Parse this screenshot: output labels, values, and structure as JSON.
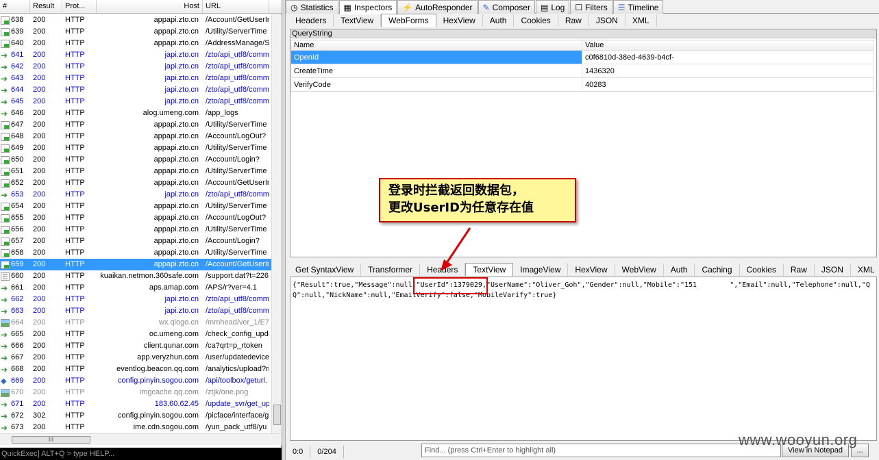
{
  "sessions": {
    "columns": [
      "#",
      "Result",
      "Prot...",
      "Host",
      "URL"
    ],
    "rows": [
      {
        "id": "638",
        "result": "200",
        "protocol": "HTTP",
        "host": "appapi.zto.cn",
        "url": "/Account/GetUserIn",
        "style": "normal",
        "icon": "js"
      },
      {
        "id": "639",
        "result": "200",
        "protocol": "HTTP",
        "host": "appapi.zto.cn",
        "url": "/Utility/ServerTime",
        "style": "normal",
        "icon": "js"
      },
      {
        "id": "640",
        "result": "200",
        "protocol": "HTTP",
        "host": "appapi.zto.cn",
        "url": "/AddressManage/Se",
        "style": "normal",
        "icon": "js"
      },
      {
        "id": "641",
        "result": "200",
        "protocol": "HTTP",
        "host": "japi.zto.cn",
        "url": "/zto/api_utf8/comm",
        "style": "blue",
        "icon": "arrow"
      },
      {
        "id": "642",
        "result": "200",
        "protocol": "HTTP",
        "host": "japi.zto.cn",
        "url": "/zto/api_utf8/comm",
        "style": "blue",
        "icon": "arrow"
      },
      {
        "id": "643",
        "result": "200",
        "protocol": "HTTP",
        "host": "japi.zto.cn",
        "url": "/zto/api_utf8/comm",
        "style": "blue",
        "icon": "arrow"
      },
      {
        "id": "644",
        "result": "200",
        "protocol": "HTTP",
        "host": "japi.zto.cn",
        "url": "/zto/api_utf8/comm",
        "style": "blue",
        "icon": "arrow"
      },
      {
        "id": "645",
        "result": "200",
        "protocol": "HTTP",
        "host": "japi.zto.cn",
        "url": "/zto/api_utf8/comm",
        "style": "blue",
        "icon": "arrow"
      },
      {
        "id": "646",
        "result": "200",
        "protocol": "HTTP",
        "host": "alog.umeng.com",
        "url": "/app_logs",
        "style": "normal",
        "icon": "arrow"
      },
      {
        "id": "647",
        "result": "200",
        "protocol": "HTTP",
        "host": "appapi.zto.cn",
        "url": "/Utility/ServerTime",
        "style": "normal",
        "icon": "js"
      },
      {
        "id": "648",
        "result": "200",
        "protocol": "HTTP",
        "host": "appapi.zto.cn",
        "url": "/Account/LogOut?",
        "style": "normal",
        "icon": "js"
      },
      {
        "id": "649",
        "result": "200",
        "protocol": "HTTP",
        "host": "appapi.zto.cn",
        "url": "/Utility/ServerTime",
        "style": "normal",
        "icon": "js"
      },
      {
        "id": "650",
        "result": "200",
        "protocol": "HTTP",
        "host": "appapi.zto.cn",
        "url": "/Account/Login?",
        "style": "normal",
        "icon": "js"
      },
      {
        "id": "651",
        "result": "200",
        "protocol": "HTTP",
        "host": "appapi.zto.cn",
        "url": "/Utility/ServerTime",
        "style": "normal",
        "icon": "js"
      },
      {
        "id": "652",
        "result": "200",
        "protocol": "HTTP",
        "host": "appapi.zto.cn",
        "url": "/Account/GetUserIn",
        "style": "normal",
        "icon": "js"
      },
      {
        "id": "653",
        "result": "200",
        "protocol": "HTTP",
        "host": "japi.zto.cn",
        "url": "/zto/api_utf8/comm",
        "style": "blue",
        "icon": "arrow"
      },
      {
        "id": "654",
        "result": "200",
        "protocol": "HTTP",
        "host": "appapi.zto.cn",
        "url": "/Utility/ServerTime",
        "style": "normal",
        "icon": "js"
      },
      {
        "id": "655",
        "result": "200",
        "protocol": "HTTP",
        "host": "appapi.zto.cn",
        "url": "/Account/LogOut?",
        "style": "normal",
        "icon": "js"
      },
      {
        "id": "656",
        "result": "200",
        "protocol": "HTTP",
        "host": "appapi.zto.cn",
        "url": "/Utility/ServerTime",
        "style": "normal",
        "icon": "js"
      },
      {
        "id": "657",
        "result": "200",
        "protocol": "HTTP",
        "host": "appapi.zto.cn",
        "url": "/Account/Login?",
        "style": "normal",
        "icon": "js"
      },
      {
        "id": "658",
        "result": "200",
        "protocol": "HTTP",
        "host": "appapi.zto.cn",
        "url": "/Utility/ServerTime",
        "style": "normal",
        "icon": "js"
      },
      {
        "id": "659",
        "result": "200",
        "protocol": "HTTP",
        "host": "appapi.zto.cn",
        "url": "/Account/GetUserIn",
        "style": "sel",
        "icon": "js"
      },
      {
        "id": "660",
        "result": "200",
        "protocol": "HTTP",
        "host": "kuaikan.netmon.360safe.com",
        "url": "/support.dat?t=226",
        "style": "normal",
        "icon": "doc"
      },
      {
        "id": "661",
        "result": "200",
        "protocol": "HTTP",
        "host": "aps.amap.com",
        "url": "/APS/r?ver=4.1",
        "style": "normal",
        "icon": "arrow"
      },
      {
        "id": "662",
        "result": "200",
        "protocol": "HTTP",
        "host": "japi.zto.cn",
        "url": "/zto/api_utf8/comm",
        "style": "blue",
        "icon": "arrow"
      },
      {
        "id": "663",
        "result": "200",
        "protocol": "HTTP",
        "host": "japi.zto.cn",
        "url": "/zto/api_utf8/comm",
        "style": "blue",
        "icon": "arrow"
      },
      {
        "id": "664",
        "result": "200",
        "protocol": "HTTP",
        "host": "wx.qlogo.cn",
        "url": "/mmhead/ver_1/E7",
        "style": "gray",
        "icon": "img"
      },
      {
        "id": "665",
        "result": "200",
        "protocol": "HTTP",
        "host": "oc.umeng.com",
        "url": "/check_config_upda",
        "style": "normal",
        "icon": "arrow"
      },
      {
        "id": "666",
        "result": "200",
        "protocol": "HTTP",
        "host": "client.qunar.com",
        "url": "/ca?qrt=p_rtoken",
        "style": "normal",
        "icon": "arrow"
      },
      {
        "id": "667",
        "result": "200",
        "protocol": "HTTP",
        "host": "app.veryzhun.com",
        "url": "/user/updatedevice",
        "style": "normal",
        "icon": "arrow"
      },
      {
        "id": "668",
        "result": "200",
        "protocol": "HTTP",
        "host": "eventlog.beacon.qq.com",
        "url": "/analytics/upload?ri",
        "style": "normal",
        "icon": "arrow"
      },
      {
        "id": "669",
        "result": "200",
        "protocol": "HTTP",
        "host": "config.pinyin.sogou.com",
        "url": "/api/toolbox/geturl.",
        "style": "blue",
        "icon": "sdch"
      },
      {
        "id": "670",
        "result": "200",
        "protocol": "HTTP",
        "host": "imgcache.qq.com",
        "url": "/ztjk/one.png",
        "style": "gray",
        "icon": "img"
      },
      {
        "id": "671",
        "result": "200",
        "protocol": "HTTP",
        "host": "183.60.62.45",
        "url": "/update_svr/get_up",
        "style": "blue",
        "icon": "arrow"
      },
      {
        "id": "672",
        "result": "302",
        "protocol": "HTTP",
        "host": "config.pinyin.sogou.com",
        "url": "/picface/interface/g",
        "style": "normal",
        "icon": "arrow"
      },
      {
        "id": "673",
        "result": "200",
        "protocol": "HTTP",
        "host": "ime.cdn.sogou.com",
        "url": "/yun_pack_utf8/yu",
        "style": "normal",
        "icon": "arrow"
      }
    ],
    "hscroll_label": "III",
    "quickexec": "QuickExec] ALT+Q > type HELP..."
  },
  "top_tabs": [
    {
      "label": "Statistics",
      "icon": "clock"
    },
    {
      "label": "Inspectors",
      "icon": "inspect"
    },
    {
      "label": "AutoResponder",
      "icon": "bolt"
    },
    {
      "label": "Composer",
      "icon": "compose"
    },
    {
      "label": "Log",
      "icon": "log"
    },
    {
      "label": "Filters",
      "icon": "check"
    },
    {
      "label": "Timeline",
      "icon": "timeline"
    }
  ],
  "request_tabs": [
    "Headers",
    "TextView",
    "WebForms",
    "HexView",
    "Auth",
    "Cookies",
    "Raw",
    "JSON",
    "XML"
  ],
  "querystring": {
    "label": "QueryString",
    "col_name": "Name",
    "col_value": "Value",
    "rows": [
      {
        "name": "OpenId",
        "value": "c0f6810d-38ed-4639-b4cf-"
      },
      {
        "name": "CreateTime",
        "value": "1436320"
      },
      {
        "name": "VerifyCode",
        "value": "40283"
      }
    ]
  },
  "callout": {
    "line1": "登录时拦截返回数据包，",
    "line2": "更改UserID为任意存在值"
  },
  "response_tabs": [
    "Get SyntaxView",
    "Transformer",
    "Headers",
    "TextView",
    "ImageView",
    "HexView",
    "WebView",
    "Auth",
    "Caching",
    "Cookies",
    "Raw",
    "JSON",
    "XML"
  ],
  "response_body": {
    "part1": "{\"Result\":true,\"Message\":null,",
    "userid": "\"UserId\":1379029",
    "part2": ",\"UserName\":\"Oliver_Goh\",\"Gender\":null,\"Mobile\":\"151",
    "part3": "\",\"Email\":null,\"Telephone\":null,\"QQ\":null,\"NickName\":null,\"EmailVerify\":false,\"MobileVarify\":true}"
  },
  "statusbar": {
    "pos": "0:0",
    "size": "0/204",
    "find_placeholder": "Find... (press Ctrl+Enter to highlight all)",
    "view_btn": "View in Notepad",
    "more_btn": "..."
  },
  "watermark": "www.wooyun.org",
  "colors": {
    "selection": "#3399ff",
    "link_row": "#0000ee",
    "callout_bg": "#fff799",
    "callout_border": "#cc0000"
  }
}
